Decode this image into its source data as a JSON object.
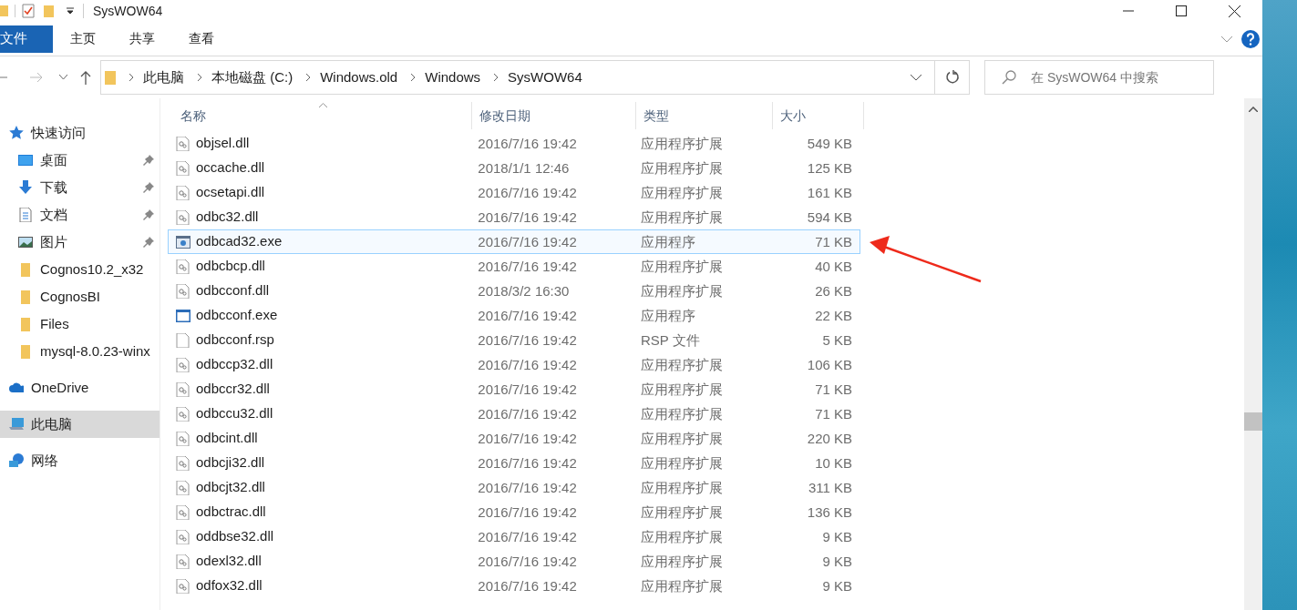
{
  "window": {
    "title": "SysWOW64"
  },
  "ribbon_tabs": [
    {
      "label": "文件",
      "selected": true
    },
    {
      "label": "主页",
      "selected": false
    },
    {
      "label": "共享",
      "selected": false
    },
    {
      "label": "查看",
      "selected": false
    }
  ],
  "breadcrumb": [
    "此电脑",
    "本地磁盘 (C:)",
    "Windows.old",
    "Windows",
    "SysWOW64"
  ],
  "search": {
    "placeholder": "在 SysWOW64 中搜索"
  },
  "sidebar": {
    "items": [
      {
        "label": "快速访问",
        "kind": "star",
        "selected": false,
        "children": [
          {
            "label": "桌面",
            "kind": "desktop",
            "pinned": true,
            "selected": false
          },
          {
            "label": "下载",
            "kind": "download",
            "pinned": true,
            "selected": false
          },
          {
            "label": "文档",
            "kind": "document",
            "pinned": true,
            "selected": false
          },
          {
            "label": "图片",
            "kind": "picture",
            "pinned": true,
            "selected": false
          },
          {
            "label": "Cognos10.2_x32",
            "kind": "folder",
            "pinned": false,
            "selected": false
          },
          {
            "label": "CognosBI",
            "kind": "folder",
            "pinned": false,
            "selected": false
          },
          {
            "label": "Files",
            "kind": "folder",
            "pinned": false,
            "selected": false
          },
          {
            "label": "mysql-8.0.23-winx",
            "kind": "folder",
            "pinned": false,
            "selected": false
          }
        ]
      },
      {
        "label": "OneDrive",
        "kind": "cloud",
        "selected": false
      },
      {
        "label": "此电脑",
        "kind": "pc",
        "selected": true
      },
      {
        "label": "网络",
        "kind": "network",
        "selected": false
      }
    ]
  },
  "table": {
    "columns": [
      "名称",
      "修改日期",
      "类型",
      "大小"
    ],
    "rows": [
      {
        "name": "objsel.dll",
        "date": "2016/7/16 19:42",
        "type": "应用程序扩展",
        "size": "549 KB",
        "kind": "dll",
        "selected": false
      },
      {
        "name": "occache.dll",
        "date": "2018/1/1 12:46",
        "type": "应用程序扩展",
        "size": "125 KB",
        "kind": "dll",
        "selected": false
      },
      {
        "name": "ocsetapi.dll",
        "date": "2016/7/16 19:42",
        "type": "应用程序扩展",
        "size": "161 KB",
        "kind": "dll",
        "selected": false
      },
      {
        "name": "odbc32.dll",
        "date": "2016/7/16 19:42",
        "type": "应用程序扩展",
        "size": "594 KB",
        "kind": "dll",
        "selected": false
      },
      {
        "name": "odbcad32.exe",
        "date": "2016/7/16 19:42",
        "type": "应用程序",
        "size": "71 KB",
        "kind": "app",
        "selected": true
      },
      {
        "name": "odbcbcp.dll",
        "date": "2016/7/16 19:42",
        "type": "应用程序扩展",
        "size": "40 KB",
        "kind": "dll",
        "selected": false
      },
      {
        "name": "odbcconf.dll",
        "date": "2018/3/2 16:30",
        "type": "应用程序扩展",
        "size": "26 KB",
        "kind": "dll",
        "selected": false
      },
      {
        "name": "odbcconf.exe",
        "date": "2016/7/16 19:42",
        "type": "应用程序",
        "size": "22 KB",
        "kind": "exe",
        "selected": false
      },
      {
        "name": "odbcconf.rsp",
        "date": "2016/7/16 19:42",
        "type": "RSP 文件",
        "size": "5 KB",
        "kind": "file",
        "selected": false
      },
      {
        "name": "odbccp32.dll",
        "date": "2016/7/16 19:42",
        "type": "应用程序扩展",
        "size": "106 KB",
        "kind": "dll",
        "selected": false
      },
      {
        "name": "odbccr32.dll",
        "date": "2016/7/16 19:42",
        "type": "应用程序扩展",
        "size": "71 KB",
        "kind": "dll",
        "selected": false
      },
      {
        "name": "odbccu32.dll",
        "date": "2016/7/16 19:42",
        "type": "应用程序扩展",
        "size": "71 KB",
        "kind": "dll",
        "selected": false
      },
      {
        "name": "odbcint.dll",
        "date": "2016/7/16 19:42",
        "type": "应用程序扩展",
        "size": "220 KB",
        "kind": "dll",
        "selected": false
      },
      {
        "name": "odbcji32.dll",
        "date": "2016/7/16 19:42",
        "type": "应用程序扩展",
        "size": "10 KB",
        "kind": "dll",
        "selected": false
      },
      {
        "name": "odbcjt32.dll",
        "date": "2016/7/16 19:42",
        "type": "应用程序扩展",
        "size": "311 KB",
        "kind": "dll",
        "selected": false
      },
      {
        "name": "odbctrac.dll",
        "date": "2016/7/16 19:42",
        "type": "应用程序扩展",
        "size": "136 KB",
        "kind": "dll",
        "selected": false
      },
      {
        "name": "oddbse32.dll",
        "date": "2016/7/16 19:42",
        "type": "应用程序扩展",
        "size": "9 KB",
        "kind": "dll",
        "selected": false
      },
      {
        "name": "odexl32.dll",
        "date": "2016/7/16 19:42",
        "type": "应用程序扩展",
        "size": "9 KB",
        "kind": "dll",
        "selected": false
      },
      {
        "name": "odfox32.dll",
        "date": "2016/7/16 19:42",
        "type": "应用程序扩展",
        "size": "9 KB",
        "kind": "dll",
        "selected": false
      }
    ]
  }
}
